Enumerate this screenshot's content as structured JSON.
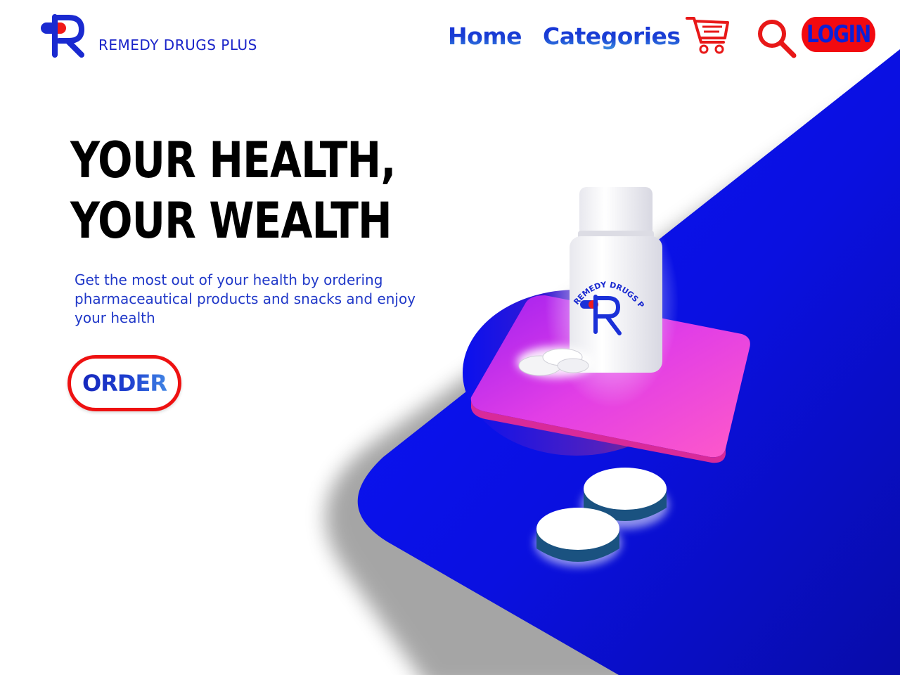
{
  "header": {
    "brand_name": "REMEDY DRUGS PLUS",
    "nav": {
      "home": "Home",
      "categories": "Categories"
    },
    "login_label": "LOGIN",
    "icons": {
      "logo": "remedy-r-logo-icon",
      "cart": "cart-icon",
      "search": "search-icon"
    }
  },
  "hero": {
    "title": "YOUR HEALTH, YOUR WEALTH",
    "description": "Get the most out of your health by ordering pharmaceautical products and snacks and enjoy your health",
    "order_label": "ORDER",
    "bottle_label": "REMEDY DRUGS PLUS"
  },
  "colors": {
    "brand_blue": "#0a12f0",
    "deep_blue": "#0a10b8",
    "accent_red": "#f20a10",
    "pink_platform": "#e63cd8",
    "text_blue": "#2038c8"
  }
}
